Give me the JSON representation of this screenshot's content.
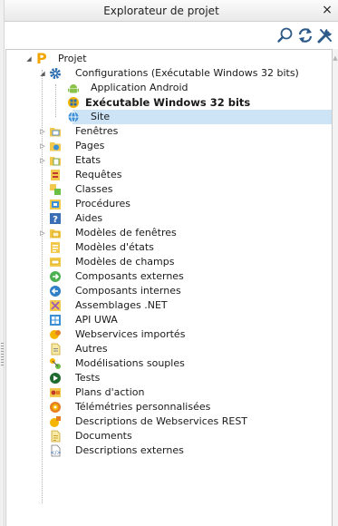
{
  "window": {
    "title": "Explorateur de projet",
    "close_glyph": "×"
  },
  "toolbar": {
    "buttons": [
      {
        "name": "search-button",
        "icon": "search-icon"
      },
      {
        "name": "refresh-button",
        "icon": "refresh-icon"
      },
      {
        "name": "settings-button",
        "icon": "wrench-icon"
      }
    ]
  },
  "tree": {
    "root": {
      "label": "Projet",
      "icon": "project-p-icon",
      "expanded": true
    },
    "configurations": {
      "label": "Configurations (Exécutable Windows 32 bits)",
      "icon": "gear-icon",
      "expanded": true
    },
    "config_items": [
      {
        "label": "Application Android",
        "icon": "android-icon",
        "bold": false,
        "selected": false
      },
      {
        "label": "Exécutable Windows 32 bits",
        "icon": "windows-exe-icon",
        "bold": true,
        "selected": false
      },
      {
        "label": "Site",
        "icon": "site-icon",
        "bold": false,
        "selected": true
      }
    ],
    "items": [
      {
        "label": "Fenêtres",
        "icon": "window-folder-icon",
        "expandable": true
      },
      {
        "label": "Pages",
        "icon": "pages-folder-icon",
        "expandable": true
      },
      {
        "label": "Etats",
        "icon": "reports-folder-icon",
        "expandable": true
      },
      {
        "label": "Requêtes",
        "icon": "query-icon",
        "expandable": false
      },
      {
        "label": "Classes",
        "icon": "class-icon",
        "expandable": false
      },
      {
        "label": "Procédures",
        "icon": "procedure-icon",
        "expandable": false
      },
      {
        "label": "Aides",
        "icon": "help-icon",
        "expandable": false
      },
      {
        "label": "Modèles de fenêtres",
        "icon": "window-template-icon",
        "expandable": true
      },
      {
        "label": "Modèles d'états",
        "icon": "report-template-icon",
        "expandable": false
      },
      {
        "label": "Modèles de champs",
        "icon": "field-template-icon",
        "expandable": false
      },
      {
        "label": "Composants externes",
        "icon": "external-component-icon",
        "expandable": false
      },
      {
        "label": "Composants internes",
        "icon": "internal-component-icon",
        "expandable": false
      },
      {
        "label": "Assemblages .NET",
        "icon": "dotnet-icon",
        "expandable": false
      },
      {
        "label": "API UWA",
        "icon": "api-uwa-icon",
        "expandable": false
      },
      {
        "label": "Webservices importés",
        "icon": "webservice-icon",
        "expandable": false
      },
      {
        "label": "Autres",
        "icon": "others-icon",
        "expandable": false
      },
      {
        "label": "Modélisations souples",
        "icon": "modeling-icon",
        "expandable": false
      },
      {
        "label": "Tests",
        "icon": "tests-icon",
        "expandable": false
      },
      {
        "label": "Plans d'action",
        "icon": "action-plan-icon",
        "expandable": false
      },
      {
        "label": "Télémétries personnalisées",
        "icon": "telemetry-icon",
        "expandable": false
      },
      {
        "label": "Descriptions de Webservices REST",
        "icon": "rest-webservice-icon",
        "expandable": false
      },
      {
        "label": "Documents",
        "icon": "document-icon",
        "expandable": false
      },
      {
        "label": "Descriptions externes",
        "icon": "external-description-icon",
        "expandable": false
      }
    ]
  }
}
